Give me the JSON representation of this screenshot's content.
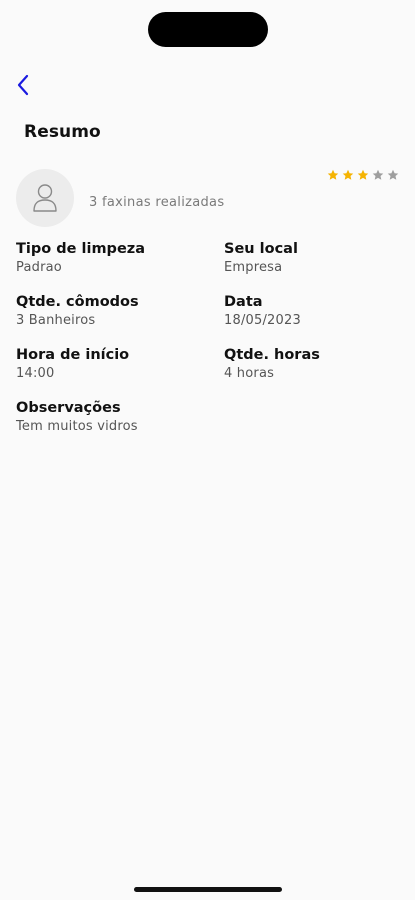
{
  "header": {
    "title": "Resumo"
  },
  "profile": {
    "jobs_count": "3 faxinas realizadas",
    "rating": 3,
    "rating_max": 5,
    "star_color_filled": "#f5b301",
    "star_color_empty": "#9e9e9e"
  },
  "fields": [
    {
      "label": "Tipo de limpeza",
      "value": "Padrao"
    },
    {
      "label": "Seu local",
      "value": "Empresa"
    },
    {
      "label": "Qtde. cômodos",
      "value": "3 Banheiros"
    },
    {
      "label": "Data",
      "value": "18/05/2023"
    },
    {
      "label": "Hora de início",
      "value": "14:00"
    },
    {
      "label": "Qtde. horas",
      "value": "4 horas"
    },
    {
      "label": "Observações",
      "value": "Tem muitos vidros"
    }
  ],
  "colors": {
    "accent": "#1a1ae0",
    "background": "#fafafa"
  }
}
